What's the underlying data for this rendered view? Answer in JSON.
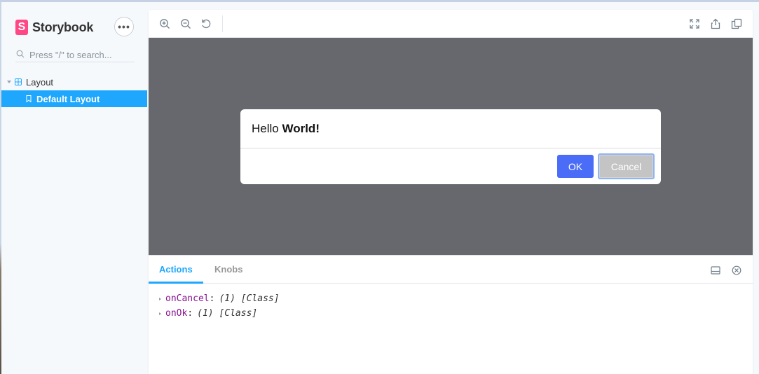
{
  "app": {
    "name": "Storybook",
    "logo_letter": "S"
  },
  "sidebar": {
    "search_placeholder": "Press \"/\" to search...",
    "tree": {
      "group_label": "Layout",
      "item_label": "Default Layout"
    }
  },
  "preview": {
    "dialog": {
      "message_prefix": "Hello ",
      "message_bold": "World!",
      "ok_label": "OK",
      "cancel_label": "Cancel"
    }
  },
  "addons": {
    "tabs": [
      {
        "label": "Actions",
        "active": true
      },
      {
        "label": "Knobs",
        "active": false
      }
    ],
    "log": [
      {
        "name": "onCancel",
        "value": "(1) [Class]"
      },
      {
        "name": "onOk",
        "value": "(1) [Class]"
      }
    ]
  },
  "colors": {
    "accent": "#1ea7fd",
    "brand": "#ff4785",
    "ok_button": "#4a6cf7",
    "canvas_bg": "#67686d"
  },
  "icons": {
    "toolbar": [
      "zoom-in-icon",
      "zoom-out-icon",
      "zoom-reset-icon",
      "fullscreen-icon",
      "share-icon",
      "copy-icon"
    ],
    "panel": [
      "panel-layout-icon",
      "close-panel-icon"
    ]
  }
}
